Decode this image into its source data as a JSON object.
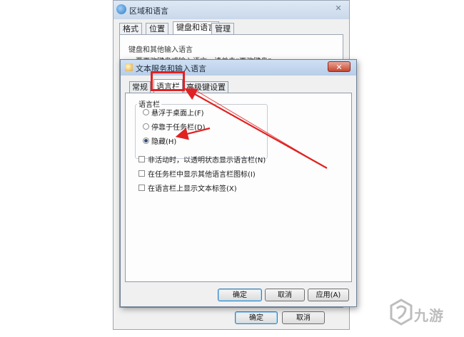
{
  "back_window": {
    "title": "区域和语言",
    "tabs": [
      {
        "label": "格式"
      },
      {
        "label": "位置"
      },
      {
        "label": "键盘和语言"
      },
      {
        "label": "管理"
      }
    ],
    "active_tab": "键盘和语言",
    "group_label": "键盘和其他输入语言",
    "hint_text": "要更改键盘或输入语言，请单击“更改键盘”。",
    "buttons": {
      "ok": "确定",
      "cancel": "取消"
    }
  },
  "front_dialog": {
    "title": "文本服务和输入语言",
    "close_glyph": "✕",
    "tabs": [
      {
        "label": "常规"
      },
      {
        "label": "语言栏"
      },
      {
        "label": "高级键设置"
      }
    ],
    "active_tab": "语言栏",
    "language_bar_group": {
      "legend": "语言栏",
      "options": [
        {
          "label": "悬浮于桌面上(F)",
          "checked": false
        },
        {
          "label": "停靠于任务栏(D)",
          "checked": false
        },
        {
          "label": "隐藏(H)",
          "checked": true
        }
      ]
    },
    "checkboxes": [
      {
        "label": "非活动时，以透明状态显示语言栏(N)",
        "checked": false
      },
      {
        "label": "在任务栏中显示其他语言栏图标(I)",
        "checked": false
      },
      {
        "label": "在语言栏上显示文本标签(X)",
        "checked": false
      }
    ],
    "buttons": {
      "ok": "确定",
      "cancel": "取消",
      "apply": "应用(A)"
    }
  },
  "annotation": {
    "color": "#e02222"
  },
  "watermark": {
    "text": "九游"
  }
}
